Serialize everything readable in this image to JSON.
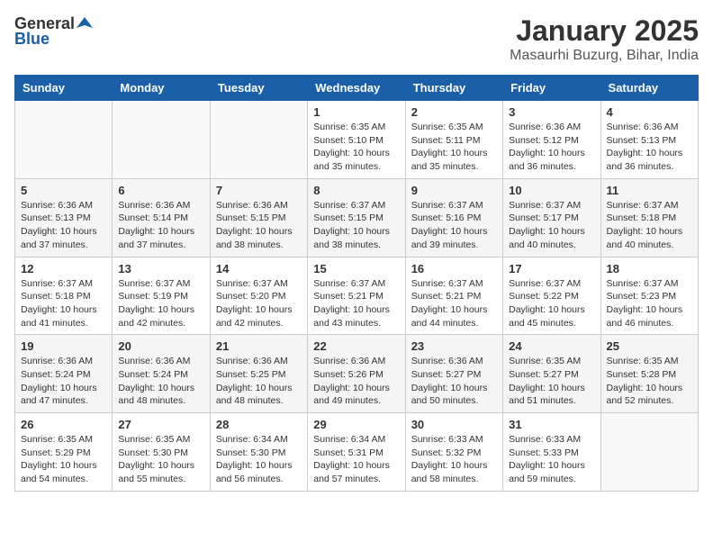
{
  "header": {
    "logo_general": "General",
    "logo_blue": "Blue",
    "month_title": "January 2025",
    "location": "Masaurhi Buzurg, Bihar, India"
  },
  "weekdays": [
    "Sunday",
    "Monday",
    "Tuesday",
    "Wednesday",
    "Thursday",
    "Friday",
    "Saturday"
  ],
  "weeks": [
    [
      {
        "day": "",
        "info": ""
      },
      {
        "day": "",
        "info": ""
      },
      {
        "day": "",
        "info": ""
      },
      {
        "day": "1",
        "info": "Sunrise: 6:35 AM\nSunset: 5:10 PM\nDaylight: 10 hours\nand 35 minutes."
      },
      {
        "day": "2",
        "info": "Sunrise: 6:35 AM\nSunset: 5:11 PM\nDaylight: 10 hours\nand 35 minutes."
      },
      {
        "day": "3",
        "info": "Sunrise: 6:36 AM\nSunset: 5:12 PM\nDaylight: 10 hours\nand 36 minutes."
      },
      {
        "day": "4",
        "info": "Sunrise: 6:36 AM\nSunset: 5:13 PM\nDaylight: 10 hours\nand 36 minutes."
      }
    ],
    [
      {
        "day": "5",
        "info": "Sunrise: 6:36 AM\nSunset: 5:13 PM\nDaylight: 10 hours\nand 37 minutes."
      },
      {
        "day": "6",
        "info": "Sunrise: 6:36 AM\nSunset: 5:14 PM\nDaylight: 10 hours\nand 37 minutes."
      },
      {
        "day": "7",
        "info": "Sunrise: 6:36 AM\nSunset: 5:15 PM\nDaylight: 10 hours\nand 38 minutes."
      },
      {
        "day": "8",
        "info": "Sunrise: 6:37 AM\nSunset: 5:15 PM\nDaylight: 10 hours\nand 38 minutes."
      },
      {
        "day": "9",
        "info": "Sunrise: 6:37 AM\nSunset: 5:16 PM\nDaylight: 10 hours\nand 39 minutes."
      },
      {
        "day": "10",
        "info": "Sunrise: 6:37 AM\nSunset: 5:17 PM\nDaylight: 10 hours\nand 40 minutes."
      },
      {
        "day": "11",
        "info": "Sunrise: 6:37 AM\nSunset: 5:18 PM\nDaylight: 10 hours\nand 40 minutes."
      }
    ],
    [
      {
        "day": "12",
        "info": "Sunrise: 6:37 AM\nSunset: 5:18 PM\nDaylight: 10 hours\nand 41 minutes."
      },
      {
        "day": "13",
        "info": "Sunrise: 6:37 AM\nSunset: 5:19 PM\nDaylight: 10 hours\nand 42 minutes."
      },
      {
        "day": "14",
        "info": "Sunrise: 6:37 AM\nSunset: 5:20 PM\nDaylight: 10 hours\nand 42 minutes."
      },
      {
        "day": "15",
        "info": "Sunrise: 6:37 AM\nSunset: 5:21 PM\nDaylight: 10 hours\nand 43 minutes."
      },
      {
        "day": "16",
        "info": "Sunrise: 6:37 AM\nSunset: 5:21 PM\nDaylight: 10 hours\nand 44 minutes."
      },
      {
        "day": "17",
        "info": "Sunrise: 6:37 AM\nSunset: 5:22 PM\nDaylight: 10 hours\nand 45 minutes."
      },
      {
        "day": "18",
        "info": "Sunrise: 6:37 AM\nSunset: 5:23 PM\nDaylight: 10 hours\nand 46 minutes."
      }
    ],
    [
      {
        "day": "19",
        "info": "Sunrise: 6:36 AM\nSunset: 5:24 PM\nDaylight: 10 hours\nand 47 minutes."
      },
      {
        "day": "20",
        "info": "Sunrise: 6:36 AM\nSunset: 5:24 PM\nDaylight: 10 hours\nand 48 minutes."
      },
      {
        "day": "21",
        "info": "Sunrise: 6:36 AM\nSunset: 5:25 PM\nDaylight: 10 hours\nand 48 minutes."
      },
      {
        "day": "22",
        "info": "Sunrise: 6:36 AM\nSunset: 5:26 PM\nDaylight: 10 hours\nand 49 minutes."
      },
      {
        "day": "23",
        "info": "Sunrise: 6:36 AM\nSunset: 5:27 PM\nDaylight: 10 hours\nand 50 minutes."
      },
      {
        "day": "24",
        "info": "Sunrise: 6:35 AM\nSunset: 5:27 PM\nDaylight: 10 hours\nand 51 minutes."
      },
      {
        "day": "25",
        "info": "Sunrise: 6:35 AM\nSunset: 5:28 PM\nDaylight: 10 hours\nand 52 minutes."
      }
    ],
    [
      {
        "day": "26",
        "info": "Sunrise: 6:35 AM\nSunset: 5:29 PM\nDaylight: 10 hours\nand 54 minutes."
      },
      {
        "day": "27",
        "info": "Sunrise: 6:35 AM\nSunset: 5:30 PM\nDaylight: 10 hours\nand 55 minutes."
      },
      {
        "day": "28",
        "info": "Sunrise: 6:34 AM\nSunset: 5:30 PM\nDaylight: 10 hours\nand 56 minutes."
      },
      {
        "day": "29",
        "info": "Sunrise: 6:34 AM\nSunset: 5:31 PM\nDaylight: 10 hours\nand 57 minutes."
      },
      {
        "day": "30",
        "info": "Sunrise: 6:33 AM\nSunset: 5:32 PM\nDaylight: 10 hours\nand 58 minutes."
      },
      {
        "day": "31",
        "info": "Sunrise: 6:33 AM\nSunset: 5:33 PM\nDaylight: 10 hours\nand 59 minutes."
      },
      {
        "day": "",
        "info": ""
      }
    ]
  ]
}
